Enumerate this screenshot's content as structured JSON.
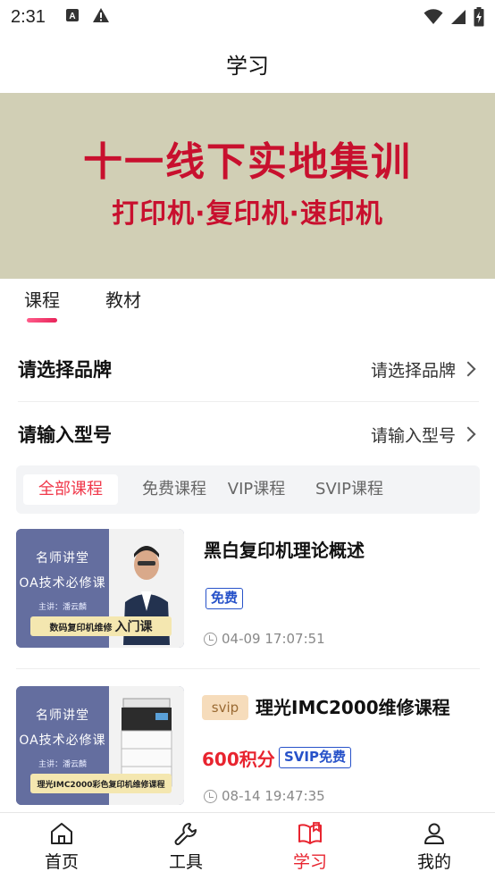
{
  "status_bar": {
    "time": "2:31",
    "left_icons": [
      "font-notification-icon",
      "warning-icon"
    ],
    "right_icons": [
      "wifi-icon",
      "signal-icon",
      "battery-charging-icon"
    ]
  },
  "header": {
    "title": "学习"
  },
  "banner": {
    "line1": "十一线下实地集训",
    "line2": "打印机·复印机·速印机",
    "text_color": "#c8102e",
    "background": "#d1cfb5"
  },
  "main_tabs": [
    {
      "label": "课程",
      "active": true
    },
    {
      "label": "教材",
      "active": false
    }
  ],
  "filters": {
    "brand": {
      "label": "请选择品牌",
      "value": "请选择品牌"
    },
    "model": {
      "label": "请输入型号",
      "value": "请输入型号"
    }
  },
  "course_tabs": [
    {
      "label": "全部课程",
      "active": true
    },
    {
      "label": "免费课程",
      "active": false
    },
    {
      "label": "VIP课程",
      "active": false
    },
    {
      "label": "SVIP课程",
      "active": false
    }
  ],
  "courses": [
    {
      "title": "黑白复印机理论概述",
      "tag": "免费",
      "time": "04-09 17:07:51",
      "thumb": {
        "line1": "名师讲堂",
        "line2": "OA技术必修课",
        "line3": "主讲：潘云麟",
        "strip": "数码复印机维修",
        "strip_emphasis": "入门课"
      }
    },
    {
      "title": "理光IMC2000维修课程",
      "level_badge": "svip",
      "points": "600积分",
      "tag": "SVIP免费",
      "time": "08-14 19:47:35",
      "thumb": {
        "line1": "名师讲堂",
        "line2": "OA技术必修课",
        "line3": "主讲：潘云麟",
        "strip": "理光IMC2000彩色复印机维修课程"
      }
    }
  ],
  "bottom_nav": [
    {
      "label": "首页",
      "icon": "home-icon",
      "active": false
    },
    {
      "label": "工具",
      "icon": "wrench-icon",
      "active": false
    },
    {
      "label": "学习",
      "icon": "book-icon",
      "active": true
    },
    {
      "label": "我的",
      "icon": "person-icon",
      "active": false
    }
  ],
  "colors": {
    "accent_red": "#e8242f",
    "tag_blue": "#2752c9",
    "svip_bg": "#f6dcbb"
  }
}
